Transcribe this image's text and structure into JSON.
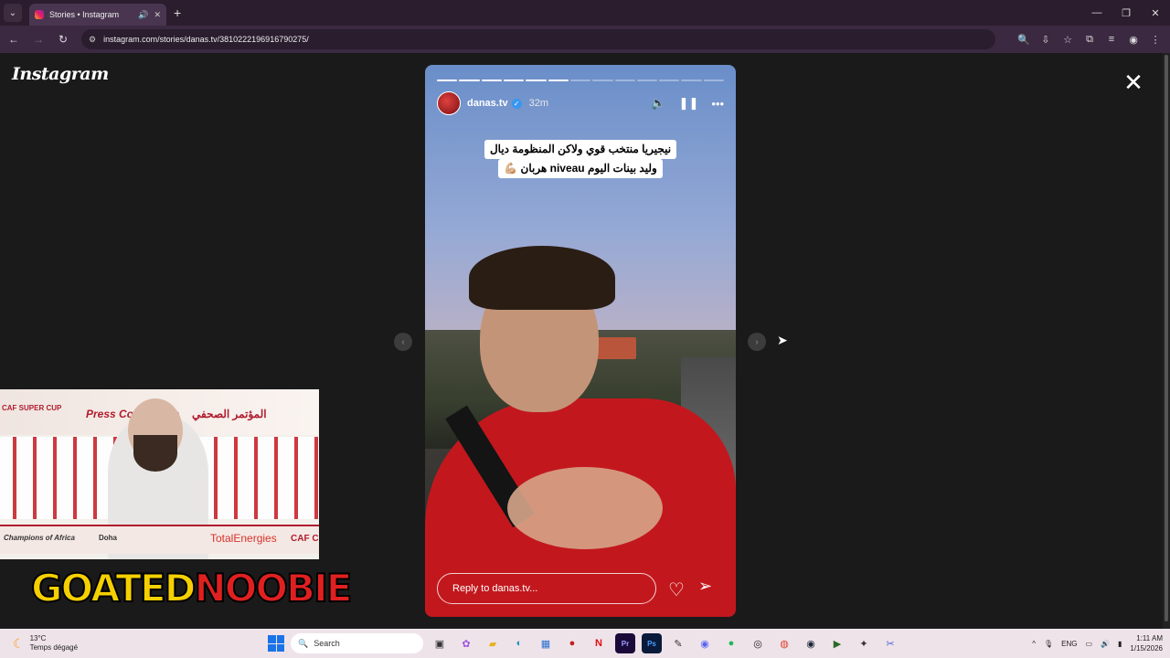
{
  "browser": {
    "tab_title": "Stories • Instagram",
    "url": "instagram.com/stories/danas.tv/3810222196916790275/"
  },
  "colors": {
    "chrome_bg": "#2b1d2e",
    "page_bg": "#1a1a1a",
    "verified_badge": "#3897f0",
    "taskbar_bg": "#efe3ea"
  },
  "instagram": {
    "logo": "Instagram"
  },
  "story": {
    "progress_total_segments": 13,
    "progress_done_segments": 6,
    "username": "danas.tv",
    "time_ago": "32m",
    "caption_line1": "نيجيريا منتخب قوي ولاكن المنظومة ديال",
    "caption_line2": "وليد بينات اليوم niveau هربان 💪🏼",
    "reply_placeholder": "Reply to danas.tv..."
  },
  "overlay": {
    "super_cup": "CAF SUPER CUP",
    "press_conference_en": "Press Conference",
    "press_conference_ar": "المؤتمر الصحفي",
    "champions": "Champions of Africa",
    "doha": "Doha",
    "total_energies": "TotalEnergies",
    "caf": "CAF C",
    "brand_part1": "GOATED",
    "brand_part2": "NOOBIE"
  },
  "taskbar": {
    "temperature": "13°C",
    "weather_desc": "Temps dégagé",
    "search_placeholder": "Search",
    "language": "ENG",
    "time": "1:11 AM",
    "date": "1/15/2026"
  }
}
